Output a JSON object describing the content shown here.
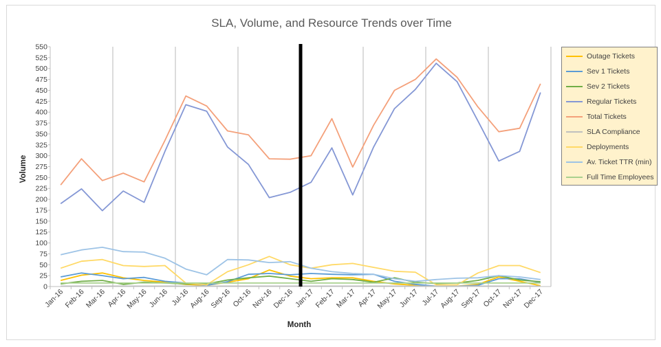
{
  "chart_data": {
    "type": "line",
    "title": "SLA, Volume, and Resource Trends over Time",
    "xlabel": "Month",
    "ylabel": "Volume",
    "ylim": [
      0,
      550
    ],
    "ytick_step": 25,
    "yticks": [
      "0",
      "25",
      "50",
      "75",
      "100",
      "125",
      "150",
      "175",
      "200",
      "225",
      "250",
      "275",
      "300",
      "325",
      "350",
      "375",
      "400",
      "425",
      "450",
      "475",
      "500",
      "525",
      "550"
    ],
    "grid": "vertical every 3 months",
    "legend_position": "right",
    "marker_line": {
      "between": [
        "Dec-16",
        "Jan-17"
      ],
      "color": "#000000"
    },
    "categories": [
      "Jan-16",
      "Feb-16",
      "Mar-16",
      "Apr-16",
      "May-16",
      "Jun-16",
      "Jul-16",
      "Aug-16",
      "Sep-16",
      "Oct-16",
      "Nov-16",
      "Dec-16",
      "Jan-17",
      "Feb-17",
      "Mar-17",
      "Apr-17",
      "May-17",
      "Jun-17",
      "Jul-17",
      "Aug-17",
      "Sep-17",
      "Oct-17",
      "Nov-17",
      "Dec-17"
    ],
    "series": [
      {
        "name": "Outage Tickets",
        "color": "#ffc000",
        "values": [
          14,
          26,
          31,
          20,
          14,
          10,
          5,
          3,
          10,
          18,
          38,
          24,
          18,
          20,
          20,
          12,
          6,
          3,
          1,
          1,
          5,
          22,
          12,
          2
        ]
      },
      {
        "name": "Sev 1 Tickets",
        "color": "#5b9bd5",
        "values": [
          22,
          31,
          25,
          18,
          21,
          12,
          8,
          3,
          11,
          28,
          30,
          27,
          30,
          28,
          27,
          28,
          12,
          5,
          1,
          1,
          3,
          18,
          18,
          9
        ]
      },
      {
        "name": "Sev 2 Tickets",
        "color": "#70ad47",
        "values": [
          6,
          12,
          14,
          5,
          10,
          8,
          6,
          6,
          15,
          20,
          24,
          18,
          12,
          18,
          16,
          10,
          20,
          10,
          7,
          8,
          14,
          25,
          15,
          11
        ]
      },
      {
        "name": "Regular Tickets",
        "color": "#8497d5",
        "values": [
          190,
          224,
          174,
          219,
          193,
          310,
          417,
          402,
          320,
          280,
          204,
          216,
          239,
          318,
          210,
          320,
          408,
          452,
          512,
          470,
          380,
          288,
          310,
          445
        ]
      },
      {
        "name": "Total Tickets",
        "color": "#f4a07a",
        "values": [
          233,
          293,
          243,
          260,
          240,
          335,
          437,
          414,
          357,
          348,
          293,
          292,
          300,
          385,
          274,
          370,
          450,
          475,
          522,
          480,
          412,
          355,
          363,
          465
        ]
      },
      {
        "name": "SLA Compliance",
        "color": "#bfbfbf",
        "values": [
          1,
          1,
          1,
          1,
          1,
          1,
          1,
          1,
          1,
          1,
          1,
          1,
          1,
          1,
          1,
          1,
          1,
          1,
          1,
          1,
          1,
          1,
          1,
          1
        ]
      },
      {
        "name": "Deployments",
        "color": "#ffd966",
        "values": [
          42,
          58,
          62,
          48,
          46,
          48,
          8,
          4,
          34,
          50,
          69,
          50,
          42,
          50,
          53,
          44,
          35,
          33,
          4,
          4,
          31,
          48,
          48,
          32
        ]
      },
      {
        "name": "Av. Ticket TTR (min)",
        "color": "#9dc3e6",
        "values": [
          73,
          84,
          90,
          80,
          79,
          65,
          40,
          27,
          62,
          61,
          55,
          57,
          42,
          34,
          30,
          28,
          18,
          12,
          16,
          19,
          20,
          25,
          22,
          16
        ]
      },
      {
        "name": "Full Time Employees",
        "color": "#a9d18e",
        "values": [
          8,
          8,
          8,
          8,
          8,
          8,
          8,
          8,
          8,
          8,
          8,
          8,
          8,
          8,
          8,
          8,
          8,
          8,
          8,
          8,
          8,
          8,
          8,
          8
        ]
      }
    ]
  }
}
